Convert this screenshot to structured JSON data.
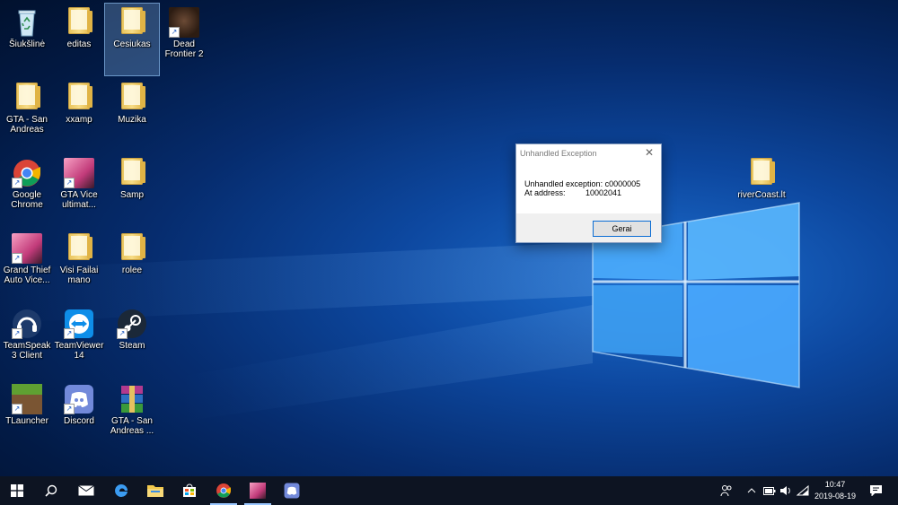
{
  "desktop_icons": [
    {
      "label": "Šiukšlinė",
      "icon": "recycle-bin-icon"
    },
    {
      "label": "editas",
      "icon": "folder-icon"
    },
    {
      "label": "Cesiukas",
      "icon": "folder-icon",
      "selected": true
    },
    {
      "label": "Dead Frontier 2",
      "icon": "dead-frontier-icon"
    },
    {
      "label": "GTA - San Andreas",
      "icon": "folder-icon"
    },
    {
      "label": "xxamp",
      "icon": "folder-icon"
    },
    {
      "label": "Muzika",
      "icon": "music-folder-icon"
    },
    {
      "label": "Google Chrome",
      "icon": "chrome-icon"
    },
    {
      "label": "GTA Vice ultimat...",
      "icon": "gta-vice-icon"
    },
    {
      "label": "Samp",
      "icon": "folder-icon"
    },
    {
      "label": "Grand Thief Auto Vice...",
      "icon": "gta-vice-icon"
    },
    {
      "label": "Visi Failai mano",
      "icon": "folder-icon"
    },
    {
      "label": "rolee",
      "icon": "folder-icon"
    },
    {
      "label": "TeamSpeak 3 Client",
      "icon": "teamspeak-icon"
    },
    {
      "label": "TeamViewer 14",
      "icon": "teamviewer-icon"
    },
    {
      "label": "Steam",
      "icon": "steam-icon"
    },
    {
      "label": "TLauncher",
      "icon": "tlauncher-icon"
    },
    {
      "label": "Discord",
      "icon": "discord-icon"
    },
    {
      "label": "GTA - San Andreas ...",
      "icon": "winrar-icon"
    },
    {
      "label": "riverCoast.lt",
      "icon": "folder-icon"
    }
  ],
  "dialog": {
    "title": "Unhandled Exception",
    "close": "✕",
    "message": "Unhandled exception: c0000005",
    "address_label": "At address:",
    "address_value": "10002041",
    "ok_button": "Gerai"
  },
  "taskbar": {
    "pinned": [
      "start-icon",
      "search-icon",
      "mail-icon",
      "edge-icon",
      "file-explorer-icon",
      "store-icon",
      "chrome-icon",
      "gta-vice-icon",
      "discord-icon"
    ],
    "tray": [
      "people-icon",
      "chevron-up-icon",
      "battery-icon",
      "volume-icon",
      "wifi-icon"
    ],
    "time": "10:47",
    "date": "2019-08-19",
    "notification": "notification-icon"
  },
  "colors": {
    "desktop_accent": "#1d6fd0",
    "taskbar_bg": "#0d1422",
    "dialog_button_border": "#0b6dd4"
  }
}
